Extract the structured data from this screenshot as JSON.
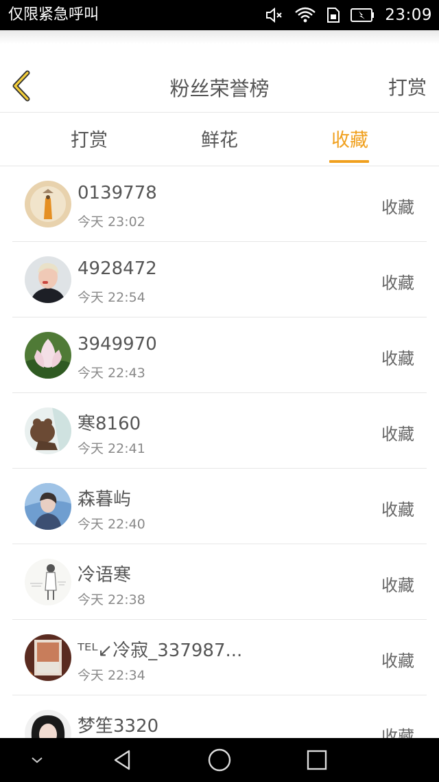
{
  "status_bar": {
    "carrier": "仅限紧急呼叫",
    "time": "23:09",
    "icons": [
      "mute-icon",
      "wifi-icon",
      "sim-icon",
      "battery-charging-icon"
    ]
  },
  "header": {
    "back_icon": "chevron-left-icon",
    "title": "粉丝荣誉榜",
    "action_label": "打赏"
  },
  "tabs": [
    {
      "label": "打赏",
      "active": false
    },
    {
      "label": "鲜花",
      "active": false
    },
    {
      "label": "收藏",
      "active": true
    }
  ],
  "colors": {
    "accent": "#f0a01e",
    "text": "#555555",
    "muted": "#888888",
    "divider": "#e6e6e6"
  },
  "list": [
    {
      "name": "0139778",
      "time": "今天 23:02",
      "action": "收藏"
    },
    {
      "name": "4928472",
      "time": "今天 22:54",
      "action": "收藏"
    },
    {
      "name": "3949970",
      "time": "今天 22:43",
      "action": "收藏"
    },
    {
      "name": "寒8160",
      "time": "今天 22:41",
      "action": "收藏"
    },
    {
      "name": "森暮屿",
      "time": "今天 22:40",
      "action": "收藏"
    },
    {
      "name": "冷语寒",
      "time": "今天 22:38",
      "action": "收藏"
    },
    {
      "name": "ᵀᴱᴸ↙冷寂_337987...",
      "time": "今天 22:34",
      "action": "收藏"
    },
    {
      "name": "梦笙3320",
      "time": "",
      "action": "收藏"
    }
  ],
  "nav_bar": {
    "icons": [
      "chevron-down-icon",
      "back-triangle-icon",
      "home-circle-icon",
      "recents-square-icon"
    ]
  }
}
